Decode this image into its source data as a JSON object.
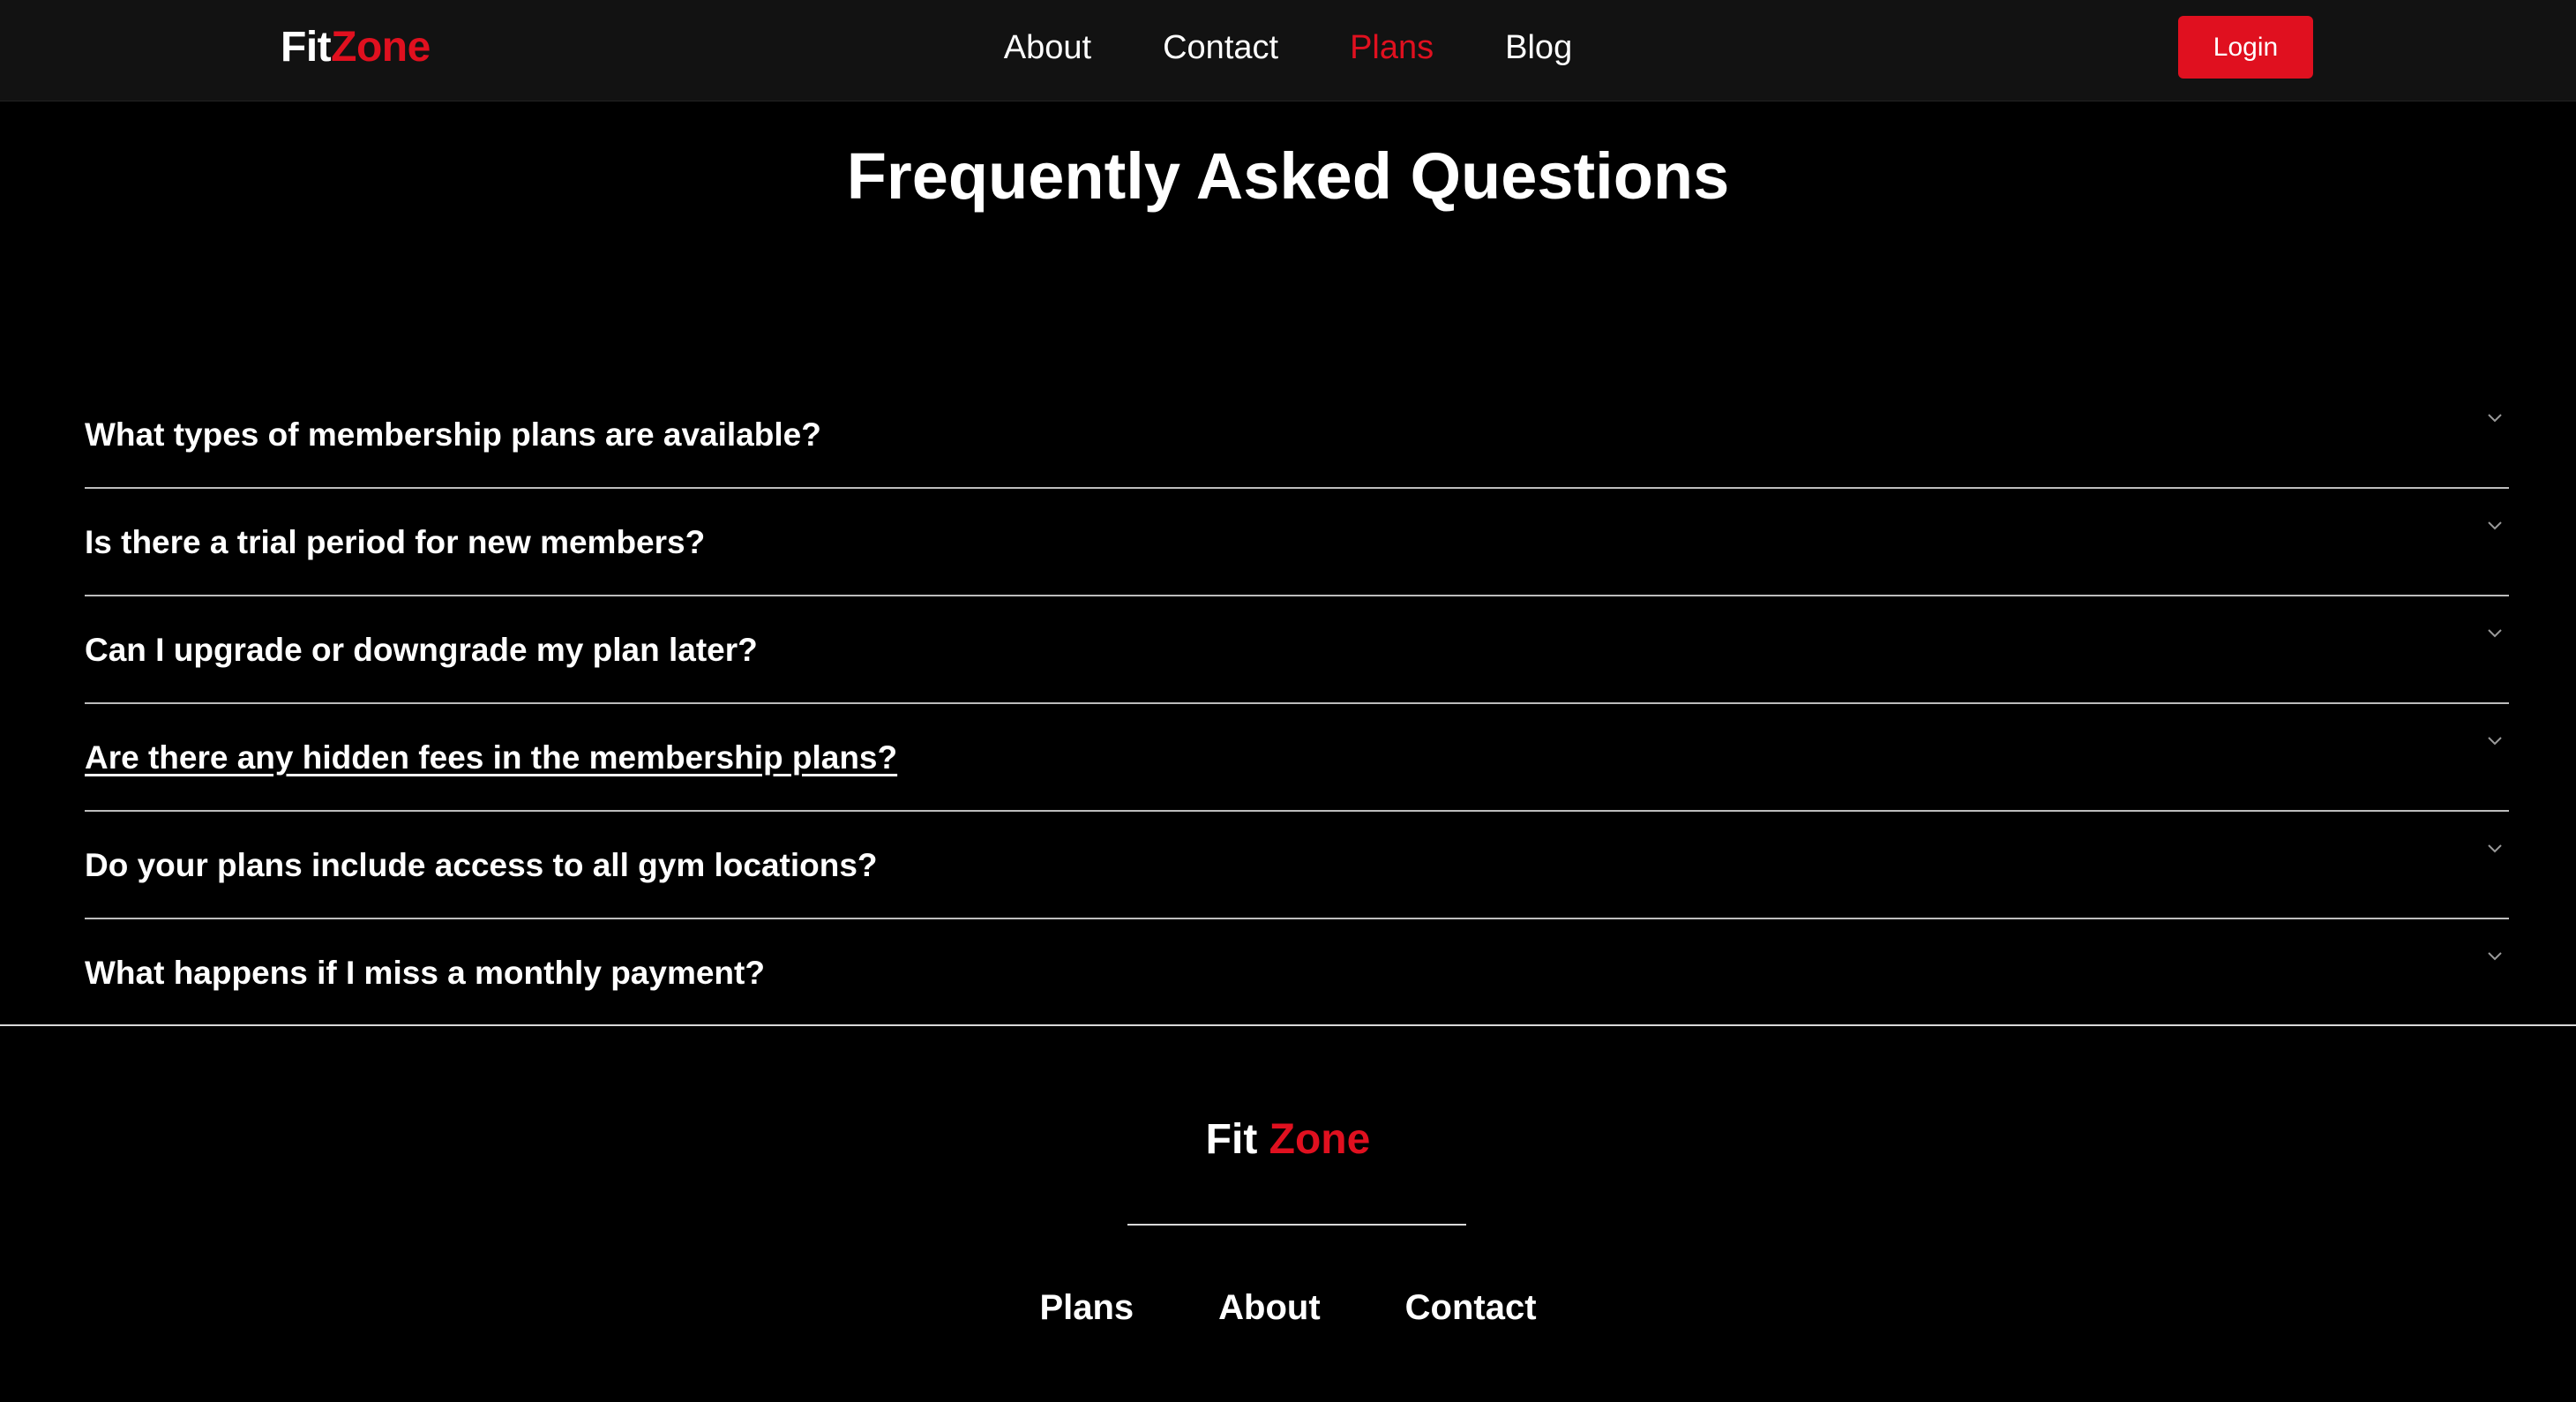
{
  "header": {
    "logo_fit": "Fit",
    "logo_zone": "Zone",
    "nav": [
      {
        "label": "About"
      },
      {
        "label": "Contact"
      },
      {
        "label": "Plans",
        "active": true
      },
      {
        "label": "Blog"
      }
    ],
    "login_label": "Login"
  },
  "faq": {
    "title": "Frequently Asked Questions",
    "items": [
      {
        "question": "What types of membership plans are available?",
        "icon": "chevron-down-icon"
      },
      {
        "question": "Is there a trial period for new members?",
        "icon": "chevron-down-icon"
      },
      {
        "question": "Can I upgrade or downgrade my plan later?",
        "icon": "chevron-down-icon"
      },
      {
        "question": "Are there any hidden fees in the membership plans?",
        "icon": "chevron-down-icon"
      },
      {
        "question": "Do your plans include access to all gym locations?",
        "icon": "chevron-down-icon"
      },
      {
        "question": "What happens if I miss a monthly payment?",
        "icon": "chevron-down-icon"
      }
    ]
  },
  "footer": {
    "logo_fit": "Fit",
    "logo_zone": "Zone",
    "links": [
      {
        "label": "Plans"
      },
      {
        "label": "About"
      },
      {
        "label": "Contact"
      }
    ]
  },
  "colors": {
    "accent": "#e0101f",
    "header_bg": "#121212",
    "page_bg": "#000000",
    "text": "#ffffff",
    "divider": "#bdbdbd"
  }
}
